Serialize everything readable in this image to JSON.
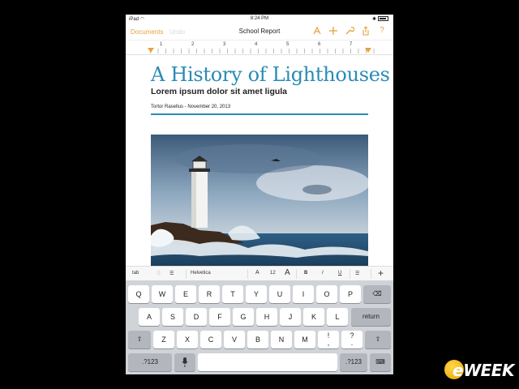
{
  "status_bar": {
    "device": "iPad",
    "time": "8:24 PM",
    "battery": ""
  },
  "nav": {
    "documents_label": "Documents",
    "undo_label": "Undo",
    "title": "School Report"
  },
  "ruler": {
    "numbers": [
      "1",
      "2",
      "3",
      "4",
      "5",
      "6",
      "7"
    ]
  },
  "document": {
    "title": "A History of Lighthouses",
    "subtitle": "Lorem ipsum dolor sit amet ligula",
    "byline": "Tortor Rasellus - November 20, 2013"
  },
  "format_bar": {
    "tab_label": "tab",
    "font_name": "Helvetica",
    "font_size": "12",
    "bold": "B",
    "italic": "I",
    "underline": "U",
    "plus": "+"
  },
  "keyboard": {
    "row1": [
      "Q",
      "W",
      "E",
      "R",
      "T",
      "Y",
      "U",
      "I",
      "O",
      "P"
    ],
    "row2": [
      "A",
      "S",
      "D",
      "F",
      "G",
      "H",
      "J",
      "K",
      "L"
    ],
    "row3": [
      "Z",
      "X",
      "C",
      "V",
      "B",
      "N",
      "M"
    ],
    "row3_punct": [
      {
        "top": "!",
        "bottom": ","
      },
      {
        "top": "?",
        "bottom": "."
      }
    ],
    "return_label": "return",
    "numbers_label": ".?123"
  },
  "watermark": {
    "text": "eWEEK"
  },
  "colors": {
    "accent": "#e8a13c",
    "title_blue": "#2a8bb5",
    "keyboard_bg": "#d0d3d8"
  }
}
